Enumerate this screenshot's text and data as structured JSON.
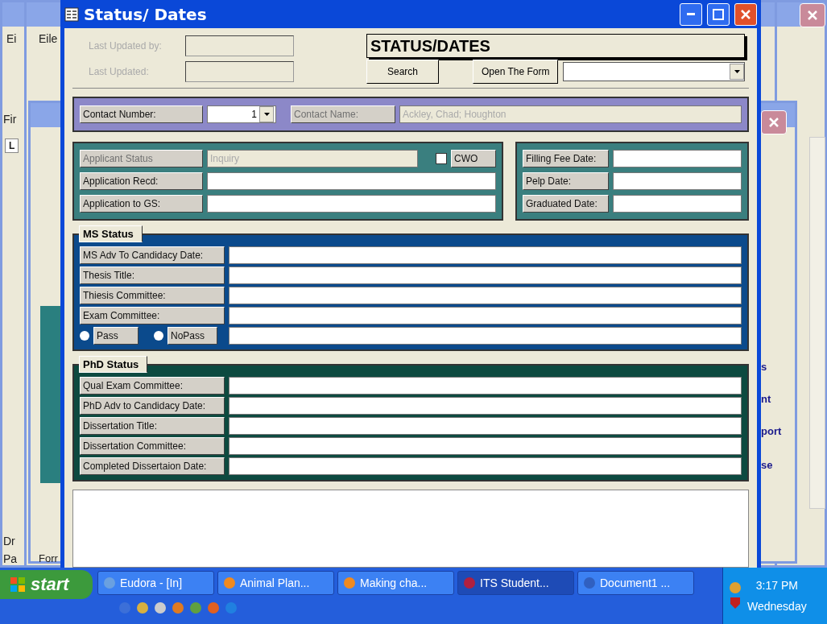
{
  "back_windows": {
    "menu_fragments": [
      "Ei",
      "Eile"
    ],
    "toolbar_fragment": "Fir",
    "ruler_fragment": "L",
    "bottom_fragments": [
      "Dr",
      "Pa",
      "Forr"
    ],
    "side_links": [
      "s",
      "nt",
      "port",
      "se"
    ]
  },
  "window": {
    "title": "Status/ Dates"
  },
  "header": {
    "audit_fields": [
      {
        "label": "Last Updated by:"
      },
      {
        "label": "Last Updated:"
      }
    ],
    "form_title": "STATUS/DATES",
    "search_button": "Search",
    "open_form_button": "Open The Form"
  },
  "contact": {
    "number_label": "Contact Number:",
    "number": "1",
    "name_label": "Contact Name:",
    "name": "Ackley, Chad; Houghton",
    "name_disabled": true
  },
  "applicant": {
    "rows": [
      {
        "label": "Applicant Status",
        "value": "Inquiry",
        "disabled": true
      },
      {
        "label": "Application Recd:",
        "disabled": false
      },
      {
        "label": "Application to GS:",
        "disabled": false
      }
    ],
    "cwo": {
      "label": "CWO",
      "checked": false
    }
  },
  "dates": [
    {
      "label": "Filling Fee Date:"
    },
    {
      "label": "Pelp Date:"
    },
    {
      "label": "Graduated Date:"
    }
  ],
  "ms_status": {
    "title": "MS Status",
    "rows": [
      {
        "label": "MS Adv To Candidacy Date:"
      },
      {
        "label": "Thesis Title:"
      },
      {
        "label": "Thiesis Committee:"
      },
      {
        "label": "Exam Committee:"
      }
    ],
    "result_options": [
      {
        "label": "Pass",
        "selected": false
      },
      {
        "label": "NoPass",
        "selected": false
      }
    ]
  },
  "phd_status": {
    "title": "PhD Status",
    "rows": [
      {
        "label": "Qual Exam Committee:"
      },
      {
        "label": "PhD Adv to Candidacy Date:"
      },
      {
        "label": "Dissertation Title:"
      },
      {
        "label": "Dissertation Committee:"
      },
      {
        "label": "Completed Dissertaion Date:"
      }
    ]
  },
  "taskbar": {
    "start": "start",
    "tasks": [
      {
        "label": "Eudora - [In]",
        "selected": false
      },
      {
        "label": "Animal Plan...",
        "selected": false
      },
      {
        "label": "Making cha...",
        "selected": false
      },
      {
        "label": "ITS Student...",
        "selected": true
      },
      {
        "label": "Document1 ...",
        "selected": false
      }
    ],
    "clock": "3:17 PM",
    "day": "Wednesday"
  }
}
